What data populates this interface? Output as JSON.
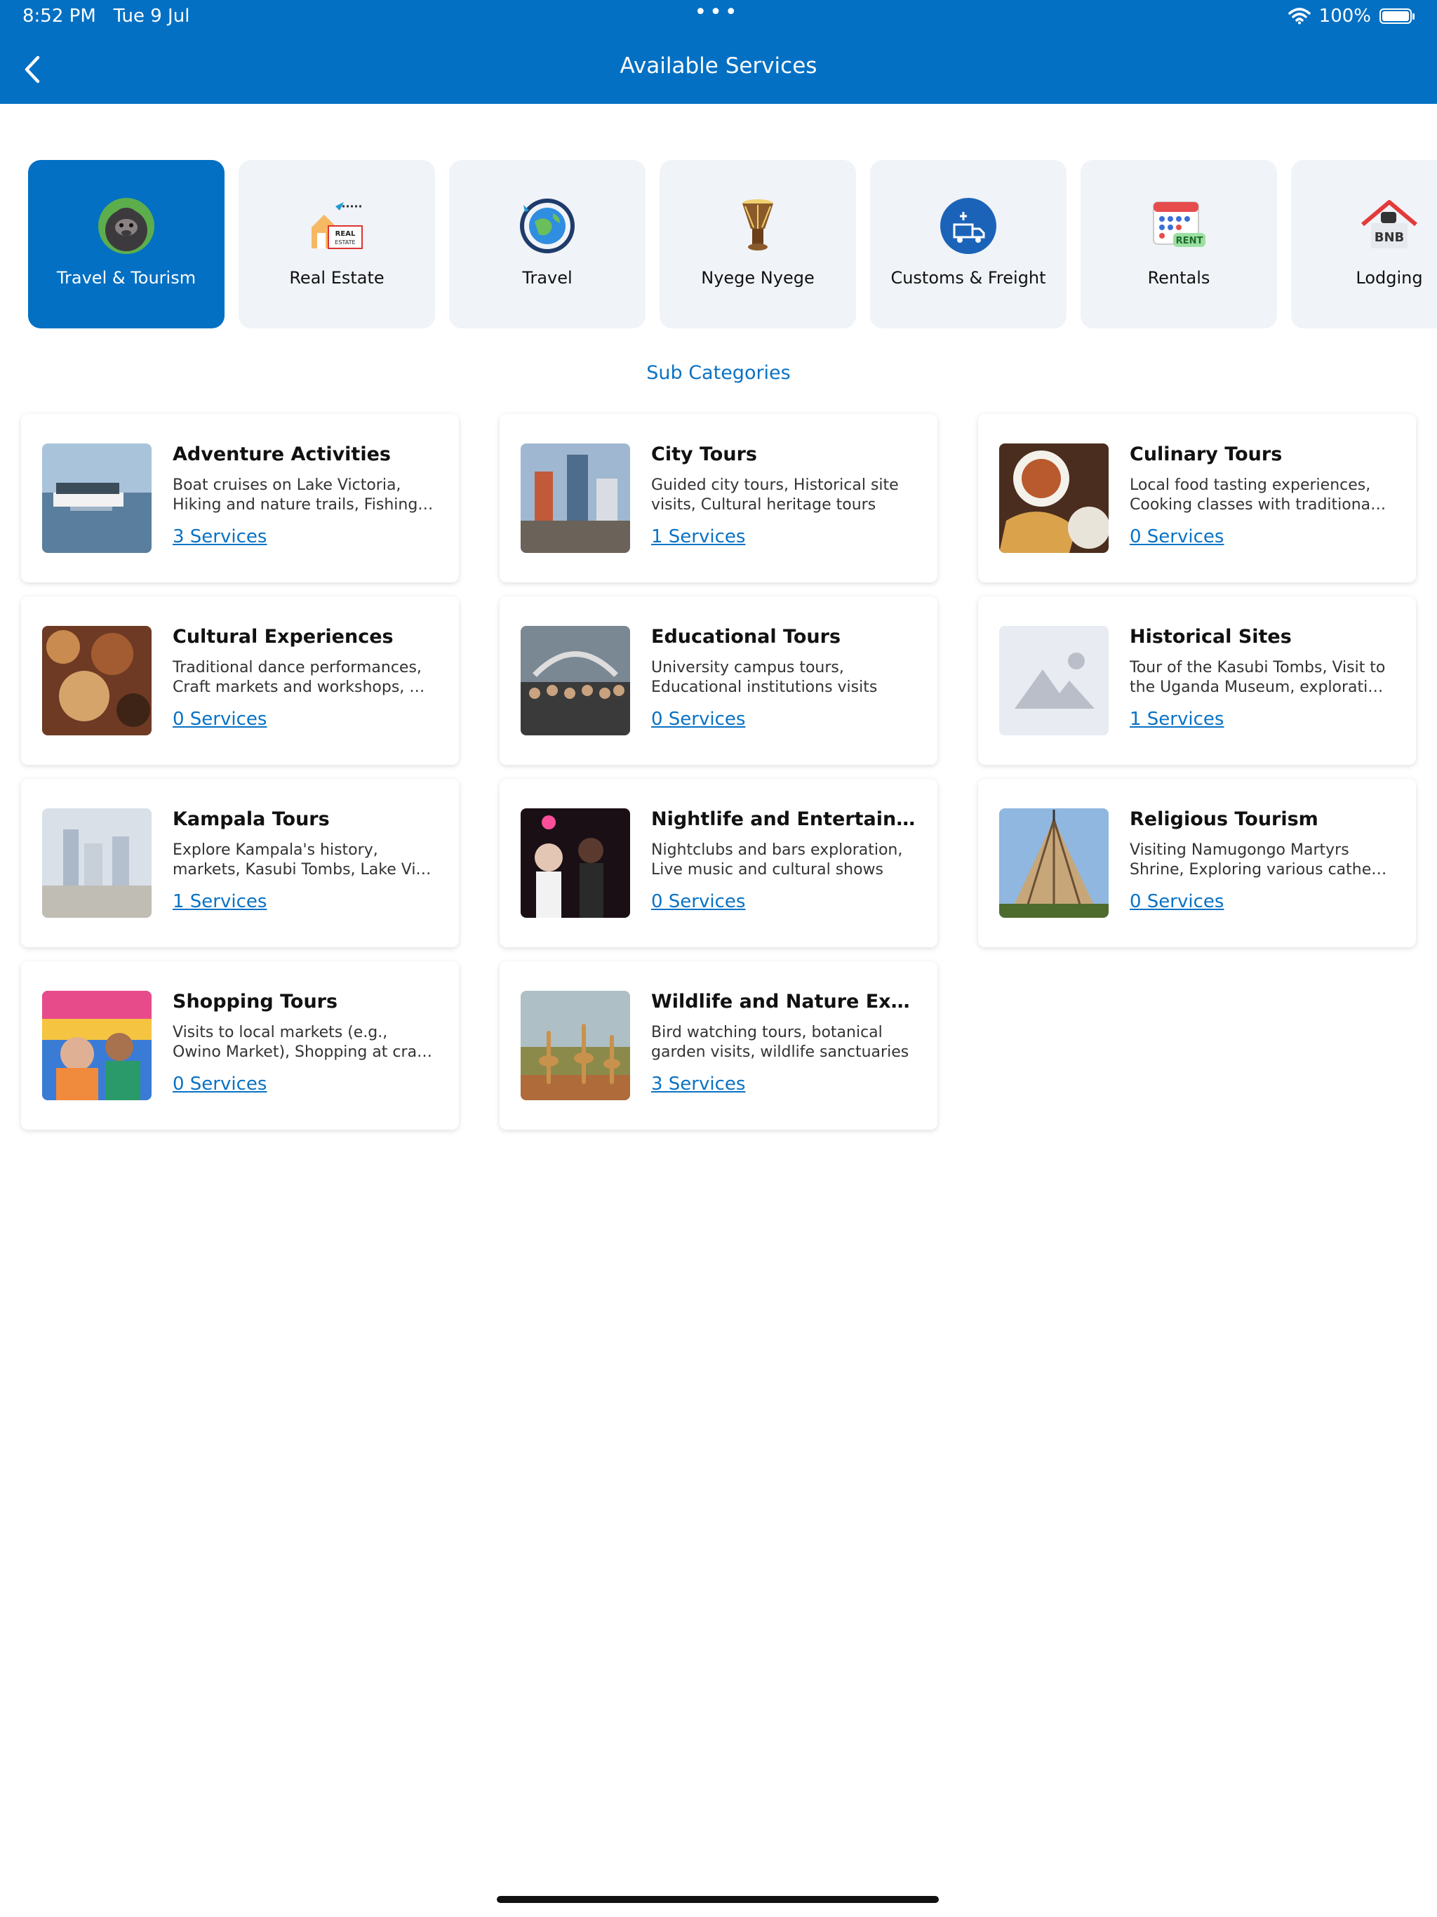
{
  "status_bar": {
    "time": "8:52 PM",
    "date": "Tue 9 Jul",
    "dots": "•••",
    "battery": "100%",
    "battery_level": 1.0
  },
  "header": {
    "title": "Available Services",
    "back_icon": "chevron-left-icon"
  },
  "categories": [
    {
      "label": "Travel & Tourism",
      "icon": "gorilla-icon",
      "active": true
    },
    {
      "label": "Real Estate",
      "icon": "real-estate-icon",
      "active": false
    },
    {
      "label": "Travel",
      "icon": "globe-icon",
      "active": false
    },
    {
      "label": "Nyege Nyege",
      "icon": "drum-icon",
      "active": false
    },
    {
      "label": "Customs & Freight",
      "icon": "truck-icon",
      "active": false
    },
    {
      "label": "Rentals",
      "icon": "rent-calendar-icon",
      "active": false
    },
    {
      "label": "Lodging",
      "icon": "bnb-house-icon",
      "active": false
    }
  ],
  "subcategories_title": "Sub Categories",
  "subcategories": [
    {
      "title": "Adventure Activities",
      "desc": "Boat cruises on Lake Victoria, Hiking and nature trails, Fishing…",
      "services": "3 Services"
    },
    {
      "title": "City Tours",
      "desc": "Guided city tours, Historical site visits, Cultural heritage tours",
      "services": "1 Services"
    },
    {
      "title": "Culinary Tours",
      "desc": "Local food tasting experiences, Cooking classes with traditiona…",
      "services": "0 Services"
    },
    {
      "title": "Cultural Experiences",
      "desc": "Traditional dance performances, Craft markets and workshops, …",
      "services": "0 Services"
    },
    {
      "title": "Educational Tours",
      "desc": "University campus tours, Educational institutions visits",
      "services": "0 Services"
    },
    {
      "title": "Historical Sites",
      "desc": "Tour of the Kasubi Tombs, Visit to the Uganda Museum, explorati…",
      "services": "1 Services"
    },
    {
      "title": "Kampala Tours",
      "desc": "Explore Kampala's history, markets, Kasubi Tombs, Lake Vi…",
      "services": "1 Services"
    },
    {
      "title": "Nightlife and Entertainm…",
      "desc": "Nightclubs and bars exploration, Live music and cultural shows",
      "services": "0 Services"
    },
    {
      "title": "Religious Tourism",
      "desc": "Visiting Namugongo Martyrs Shrine, Exploring various cathe…",
      "services": "0 Services"
    },
    {
      "title": "Shopping Tours",
      "desc": "Visits to local markets (e.g., Owino Market), Shopping at cra…",
      "services": "0 Services"
    },
    {
      "title": "Wildlife and Nature Excu…",
      "desc": "Bird watching tours, botanical garden visits, wildlife sanctuaries",
      "services": "3 Services"
    }
  ],
  "colors": {
    "primary": "#0370c3",
    "link": "#0a72c4",
    "tile_bg": "#f0f3f7"
  }
}
